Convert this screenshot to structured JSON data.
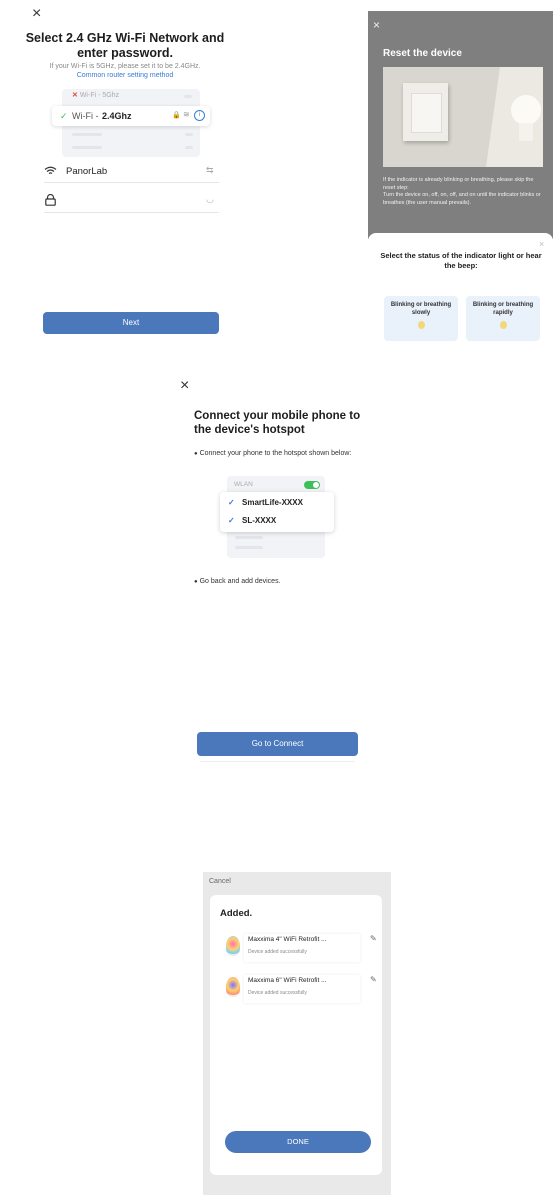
{
  "screen1": {
    "close_icon": "×",
    "title": "Select 2.4 GHz Wi-Fi Network and enter password.",
    "subtitle": "If your Wi-Fi is 5GHz, please set it to be 2.4GHz.",
    "link": "Common router setting method",
    "row_5ghz": "Wi-Fi - 5Ghz",
    "row_24ghz_prefix": "Wi-Fi - ",
    "row_24ghz_band": "2.4Ghz",
    "network_name": "PanorLab",
    "password_value": "",
    "next_label": "Next"
  },
  "screen2": {
    "close_icon": "×",
    "title": "Reset the device",
    "instructions_1": "If the indicator is already blinking or breathing, please skip the reset step:",
    "instructions_2": "Turn the device on, off, on, off, and on until the indicator blinks or breathes (the user manual prevails).",
    "sheet_close": "×",
    "sheet_title": "Select the status of the indicator light or hear the beep:",
    "option_slow": "Blinking or breathing slowly",
    "option_rapid": "Blinking or breathing rapidly"
  },
  "screen3": {
    "close_icon": "×",
    "title": "Connect your mobile phone to the device's hotspot",
    "step1": "Connect your phone to the hotspot shown below:",
    "wlan_label": "WLAN",
    "hotspot_1": "SmartLife-XXXX",
    "hotspot_2": "SL-XXXX",
    "step2": "Go back and add devices.",
    "connect_label": "Go to Connect"
  },
  "screen4": {
    "cancel_label": "Cancel",
    "added_title": "Added.",
    "devices": [
      {
        "name": "Maxxima 4\" WiFi Retrofit ...",
        "status": "Device added successfully"
      },
      {
        "name": "Maxxima 6\" WiFi Retrofit ...",
        "status": "Device added successfully"
      }
    ],
    "done_label": "DONE"
  },
  "colors": {
    "primary_button": "#4a78bb",
    "link": "#3a7bd5",
    "check_green": "#3fbf5a",
    "check_blue": "#3a7bd5",
    "error_red": "#e0443a"
  }
}
